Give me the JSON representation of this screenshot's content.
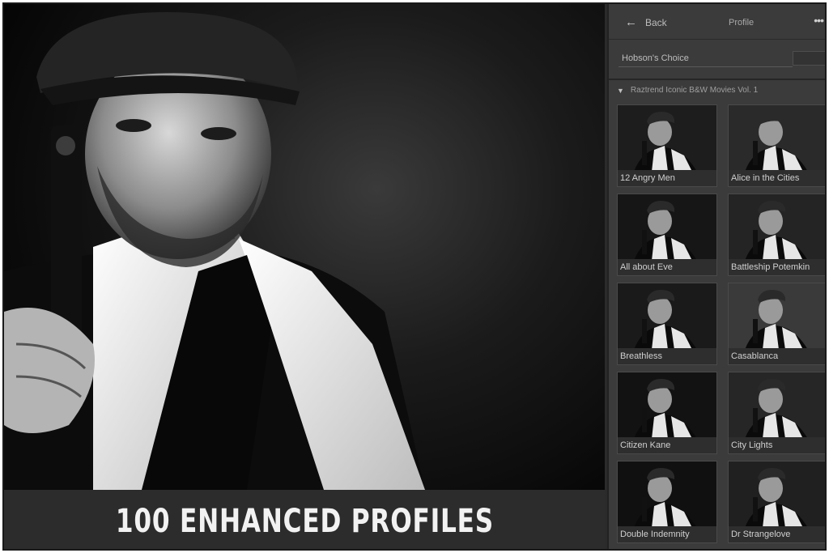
{
  "banner": {
    "text": "100 ENHANCED PROFILES"
  },
  "panel": {
    "back_label": "Back",
    "title": "Profile",
    "more_label": "•••",
    "current_profile": "Hobson's Choice",
    "group_label": "Raztrend Iconic B&W Movies Vol. 1",
    "profiles": [
      {
        "label": "12 Angry Men",
        "tone": "#1d1d1d"
      },
      {
        "label": "Alice in the Cities",
        "tone": "#2a2a2a"
      },
      {
        "label": "All about Eve",
        "tone": "#161616"
      },
      {
        "label": "Battleship Potemkin",
        "tone": "#242424"
      },
      {
        "label": "Breathless",
        "tone": "#1a1a1a"
      },
      {
        "label": "Casablanca",
        "tone": "#3a3a3a"
      },
      {
        "label": "Citizen Kane",
        "tone": "#121212"
      },
      {
        "label": "City Lights",
        "tone": "#262626"
      },
      {
        "label": "Double Indemnity",
        "tone": "#101010"
      },
      {
        "label": "Dr Strangelove",
        "tone": "#202020"
      }
    ]
  },
  "colors": {
    "panel_bg": "#3b3b3b",
    "banner_bg": "#2c2c2c",
    "banner_text": "#f2f2f2"
  }
}
